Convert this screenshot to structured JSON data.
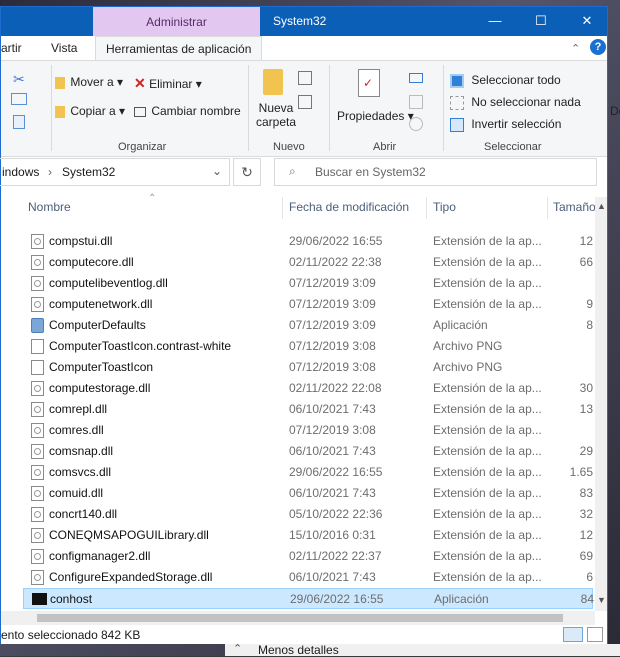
{
  "titlebar": {
    "context_tab": "Administrar",
    "title": "System32"
  },
  "ribbon_tabs": [
    "artir",
    "Vista",
    "Herramientas de aplicación"
  ],
  "ribbon": {
    "organizar": {
      "move_to": "Mover a",
      "copy_to": "Copiar a",
      "delete": "Eliminar",
      "rename": "Cambiar nombre"
    },
    "nuevo": {
      "new_folder_line1": "Nueva",
      "new_folder_line2": "carpeta"
    },
    "abrir": {
      "properties": "Propiedades"
    },
    "seleccionar": {
      "select_all": "Seleccionar todo",
      "select_none": "No seleccionar nada",
      "invert": "Invertir selección"
    },
    "groups": [
      "Organizar",
      "Nuevo",
      "Abrir",
      "Seleccionar"
    ]
  },
  "address": {
    "crumbs": [
      "indows",
      "System32"
    ]
  },
  "search": {
    "placeholder": "Buscar en System32"
  },
  "columns": [
    "Nombre",
    "Fecha de modificación",
    "Tipo",
    "Tamaño"
  ],
  "files": [
    {
      "name": "compstui.dll",
      "date": "29/06/2022 16:55",
      "type": "Extensión de la ap...",
      "size": "12",
      "icon": "dll"
    },
    {
      "name": "computecore.dll",
      "date": "02/11/2022 22:38",
      "type": "Extensión de la ap...",
      "size": "66",
      "icon": "dll"
    },
    {
      "name": "computelibeventlog.dll",
      "date": "07/12/2019 3:09",
      "type": "Extensión de la ap...",
      "size": "",
      "icon": "dll"
    },
    {
      "name": "computenetwork.dll",
      "date": "07/12/2019 3:09",
      "type": "Extensión de la ap...",
      "size": "9",
      "icon": "dll"
    },
    {
      "name": "ComputerDefaults",
      "date": "07/12/2019 3:09",
      "type": "Aplicación",
      "size": "8",
      "icon": "app"
    },
    {
      "name": "ComputerToastIcon.contrast-white",
      "date": "07/12/2019 3:08",
      "type": "Archivo PNG",
      "size": "",
      "icon": "png"
    },
    {
      "name": "ComputerToastIcon",
      "date": "07/12/2019 3:08",
      "type": "Archivo PNG",
      "size": "",
      "icon": "png"
    },
    {
      "name": "computestorage.dll",
      "date": "02/11/2022 22:08",
      "type": "Extensión de la ap...",
      "size": "30",
      "icon": "dll"
    },
    {
      "name": "comrepl.dll",
      "date": "06/10/2021 7:43",
      "type": "Extensión de la ap...",
      "size": "13",
      "icon": "dll"
    },
    {
      "name": "comres.dll",
      "date": "07/12/2019 3:08",
      "type": "Extensión de la ap...",
      "size": "",
      "icon": "dll"
    },
    {
      "name": "comsnap.dll",
      "date": "06/10/2021 7:43",
      "type": "Extensión de la ap...",
      "size": "29",
      "icon": "dll"
    },
    {
      "name": "comsvcs.dll",
      "date": "29/06/2022 16:55",
      "type": "Extensión de la ap...",
      "size": "1.65",
      "icon": "dll"
    },
    {
      "name": "comuid.dll",
      "date": "06/10/2021 7:43",
      "type": "Extensión de la ap...",
      "size": "83",
      "icon": "dll"
    },
    {
      "name": "concrt140.dll",
      "date": "05/10/2022 22:36",
      "type": "Extensión de la ap...",
      "size": "32",
      "icon": "dll"
    },
    {
      "name": "CONEQMSAPOGUILibrary.dll",
      "date": "15/10/2016 0:31",
      "type": "Extensión de la ap...",
      "size": "12",
      "icon": "dll"
    },
    {
      "name": "configmanager2.dll",
      "date": "02/11/2022 22:37",
      "type": "Extensión de la ap...",
      "size": "69",
      "icon": "dll"
    },
    {
      "name": "ConfigureExpandedStorage.dll",
      "date": "06/10/2021 7:43",
      "type": "Extensión de la ap...",
      "size": "6",
      "icon": "dll"
    },
    {
      "name": "conhost",
      "date": "29/06/2022 16:55",
      "type": "Aplicación",
      "size": "84",
      "icon": "console",
      "selected": true
    }
  ],
  "status": {
    "selection": "ento seleccionado",
    "size": "842 KB"
  },
  "background": {
    "less_details": "Menos detalles",
    "edge_text": "De"
  },
  "colors": {
    "titlebar": "#0c5fb7",
    "context_tab": "#e2c8f0",
    "selection": "#cce8ff"
  }
}
